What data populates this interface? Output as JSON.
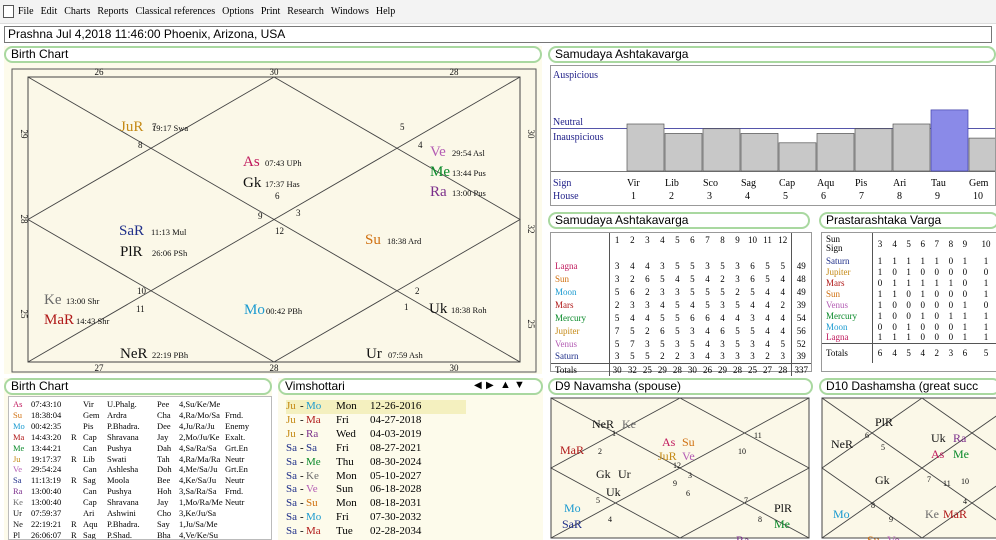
{
  "menu": [
    "File",
    "Edit",
    "Charts",
    "Reports",
    "Classical references",
    "Options",
    "Print",
    "Research",
    "Windows",
    "Help"
  ],
  "header": "Prashna   Jul 4,2018 11:46:00   Phoenix, Arizona, USA",
  "birth_chart": {
    "title": "Birth Chart",
    "outer_top": [
      "26",
      "30",
      "28"
    ],
    "outer_bottom": [
      "27",
      "28",
      "30"
    ],
    "outer_left": [
      "29",
      "28",
      "25"
    ],
    "outer_right": [
      "30",
      "32",
      "25"
    ],
    "house_numbers": [
      "7",
      "8",
      "6",
      "5",
      "4",
      "9",
      "3",
      "12",
      "10",
      "11",
      "1",
      "2"
    ],
    "planets": [
      {
        "abbr": "JuR",
        "info": "19:17 Swa",
        "color": "#c58a16"
      },
      {
        "abbr": "As",
        "info": "07:43 UPh",
        "color": "#c0185c"
      },
      {
        "abbr": "Gk",
        "info": "17:37 Has",
        "color": "#111111"
      },
      {
        "abbr": "Ve",
        "info": "29:54 Asl",
        "color": "#b35bb3"
      },
      {
        "abbr": "Me",
        "info": "13:44 Pus",
        "color": "#0a8a2a"
      },
      {
        "abbr": "Ra",
        "info": "13:00 Pus",
        "color": "#7a2d8a"
      },
      {
        "abbr": "SaR",
        "info": "11:13 Mul",
        "color": "#1f2f8a"
      },
      {
        "abbr": "PlR",
        "info": "26:06 PSh",
        "color": "#111111"
      },
      {
        "abbr": "Su",
        "info": "18:38 Ard",
        "color": "#d07010"
      },
      {
        "abbr": "Ke",
        "info": "13:00 Shr",
        "color": "#6a6a6a"
      },
      {
        "abbr": "MaR",
        "info": "14:43 Shr",
        "color": "#b01818"
      },
      {
        "abbr": "Mo",
        "info": "00:42 PBh",
        "color": "#1a9ad0"
      },
      {
        "abbr": "Uk",
        "info": "18:38 Roh",
        "color": "#111111"
      },
      {
        "abbr": "NeR",
        "info": "22:19 PBh",
        "color": "#111111"
      },
      {
        "abbr": "Ur",
        "info": "07:59 Ash",
        "color": "#111111"
      }
    ]
  },
  "samudaya_top": {
    "title": "Samudaya Ashtakavarga",
    "auspicious": "Auspicious",
    "neutral": "Neutral",
    "inauspicious": "Inauspicious",
    "sign_label": "Sign",
    "house_label": "House",
    "signs": [
      "Vir",
      "Lib",
      "Sco",
      "Sag",
      "Cap",
      "Aqu",
      "Pis",
      "Ari",
      "Tau",
      "Gem"
    ],
    "houses": [
      "1",
      "2",
      "3",
      "4",
      "5",
      "6",
      "7",
      "8",
      "9",
      "10"
    ],
    "bar_values": [
      30,
      28,
      29,
      28,
      26,
      28,
      29,
      30,
      33,
      27
    ],
    "highlight_index": 8
  },
  "samudaya_table": {
    "title": "Samudaya Ashtakavarga",
    "columns": [
      "1",
      "2",
      "3",
      "4",
      "5",
      "6",
      "7",
      "8",
      "9",
      "10",
      "11",
      "12"
    ],
    "rows": [
      {
        "name": "Lagna",
        "color": "#c0185c",
        "vals": [
          "3",
          "4",
          "4",
          "3",
          "5",
          "5",
          "3",
          "5",
          "3",
          "6",
          "5",
          "5"
        ],
        "total": "49"
      },
      {
        "name": "Sun",
        "color": "#d07010",
        "vals": [
          "3",
          "2",
          "6",
          "5",
          "4",
          "5",
          "4",
          "2",
          "3",
          "6",
          "5",
          "4"
        ],
        "total": "48"
      },
      {
        "name": "Moon",
        "color": "#1a9ad0",
        "vals": [
          "5",
          "6",
          "2",
          "3",
          "3",
          "5",
          "5",
          "5",
          "2",
          "5",
          "4",
          "4"
        ],
        "total": "49"
      },
      {
        "name": "Mars",
        "color": "#b01818",
        "vals": [
          "2",
          "3",
          "3",
          "4",
          "5",
          "4",
          "5",
          "3",
          "5",
          "4",
          "4",
          "2"
        ],
        "total": "39"
      },
      {
        "name": "Mercury",
        "color": "#0a8a2a",
        "vals": [
          "5",
          "4",
          "4",
          "5",
          "5",
          "6",
          "6",
          "4",
          "4",
          "3",
          "4",
          "4"
        ],
        "total": "54"
      },
      {
        "name": "Jupiter",
        "color": "#c58a16",
        "vals": [
          "7",
          "5",
          "2",
          "6",
          "5",
          "3",
          "4",
          "6",
          "5",
          "5",
          "4",
          "4"
        ],
        "total": "56"
      },
      {
        "name": "Venus",
        "color": "#b35bb3",
        "vals": [
          "5",
          "7",
          "3",
          "5",
          "3",
          "5",
          "4",
          "3",
          "5",
          "3",
          "4",
          "5"
        ],
        "total": "52"
      },
      {
        "name": "Saturn",
        "color": "#1f2f8a",
        "vals": [
          "3",
          "5",
          "5",
          "2",
          "2",
          "3",
          "4",
          "3",
          "3",
          "3",
          "2",
          "3"
        ],
        "total": "39"
      }
    ],
    "totals_label": "Totals",
    "totals": [
      "30",
      "32",
      "25",
      "29",
      "28",
      "30",
      "26",
      "29",
      "28",
      "25",
      "27",
      "28"
    ],
    "grand_total": "337"
  },
  "prastarashtaka": {
    "title": "Prastarashtaka Varga",
    "header_a": "Sun",
    "header_b": "Sign",
    "columns": [
      "3",
      "4",
      "5",
      "6",
      "7",
      "8",
      "9",
      "10"
    ],
    "rows": [
      {
        "name": "Saturn",
        "color": "#1f2f8a",
        "vals": [
          "1",
          "1",
          "1",
          "1",
          "1",
          "0",
          "1",
          "1"
        ]
      },
      {
        "name": "Jupiter",
        "color": "#c58a16",
        "vals": [
          "1",
          "0",
          "1",
          "0",
          "0",
          "0",
          "0",
          "0"
        ]
      },
      {
        "name": "Mars",
        "color": "#b01818",
        "vals": [
          "0",
          "1",
          "1",
          "1",
          "1",
          "1",
          "0",
          "1"
        ]
      },
      {
        "name": "Sun",
        "color": "#d07010",
        "vals": [
          "1",
          "1",
          "0",
          "1",
          "0",
          "0",
          "0",
          "1"
        ]
      },
      {
        "name": "Venus",
        "color": "#b35bb3",
        "vals": [
          "1",
          "0",
          "0",
          "0",
          "0",
          "0",
          "1",
          "0"
        ]
      },
      {
        "name": "Mercury",
        "color": "#0a8a2a",
        "vals": [
          "1",
          "0",
          "0",
          "1",
          "0",
          "1",
          "1",
          "1"
        ]
      },
      {
        "name": "Moon",
        "color": "#1a9ad0",
        "vals": [
          "0",
          "0",
          "1",
          "0",
          "0",
          "0",
          "1",
          "1"
        ]
      },
      {
        "name": "Lagna",
        "color": "#c0185c",
        "vals": [
          "1",
          "1",
          "1",
          "0",
          "0",
          "0",
          "1",
          "1"
        ]
      }
    ],
    "totals_label": "Totals",
    "totals": [
      "6",
      "4",
      "5",
      "4",
      "2",
      "3",
      "6",
      "5"
    ]
  },
  "birth_list": {
    "title": "Birth Chart",
    "rows": [
      {
        "p": "As",
        "c": "#c0185c",
        "deg": "07:43:10",
        "r": "",
        "sign": "Vir",
        "nak": "U.Phalg.",
        "pada": "Pee",
        "lord": "4,Su/Ke/Me",
        "st": ""
      },
      {
        "p": "Su",
        "c": "#d07010",
        "deg": "18:38:04",
        "r": "",
        "sign": "Gem",
        "nak": "Ardra",
        "pada": "Cha",
        "lord": "4,Ra/Mo/Sa",
        "st": "Frnd."
      },
      {
        "p": "Mo",
        "c": "#1a9ad0",
        "deg": "00:42:35",
        "r": "",
        "sign": "Pis",
        "nak": "P.Bhadra.",
        "pada": "Dee",
        "lord": "4,Ju/Ra/Ju",
        "st": "Enemy"
      },
      {
        "p": "Ma",
        "c": "#b01818",
        "deg": "14:43:20",
        "r": "R",
        "sign": "Cap",
        "nak": "Shravana",
        "pada": "Jay",
        "lord": "2,Mo/Ju/Ke",
        "st": "Exalt."
      },
      {
        "p": "Me",
        "c": "#0a8a2a",
        "deg": "13:44:21",
        "r": "",
        "sign": "Can",
        "nak": "Pushya",
        "pada": "Dah",
        "lord": "4,Sa/Ra/Sa",
        "st": "Grt.En"
      },
      {
        "p": "Ju",
        "c": "#c58a16",
        "deg": "19:17:37",
        "r": "R",
        "sign": "Lib",
        "nak": "Swati",
        "pada": "Tah",
        "lord": "4,Ra/Ma/Ra",
        "st": "Neutr"
      },
      {
        "p": "Ve",
        "c": "#b35bb3",
        "deg": "29:54:24",
        "r": "",
        "sign": "Can",
        "nak": "Ashlesha",
        "pada": "Doh",
        "lord": "4,Me/Sa/Ju",
        "st": "Grt.En"
      },
      {
        "p": "Sa",
        "c": "#1f2f8a",
        "deg": "11:13:19",
        "r": "R",
        "sign": "Sag",
        "nak": "Moola",
        "pada": "Bee",
        "lord": "4,Ke/Sa/Ju",
        "st": "Neutr"
      },
      {
        "p": "Ra",
        "c": "#7a2d8a",
        "deg": "13:00:40",
        "r": "",
        "sign": "Can",
        "nak": "Pushya",
        "pada": "Hoh",
        "lord": "3,Sa/Ra/Sa",
        "st": "Frnd."
      },
      {
        "p": "Ke",
        "c": "#6a6a6a",
        "deg": "13:00:40",
        "r": "",
        "sign": "Cap",
        "nak": "Shravana",
        "pada": "Jay",
        "lord": "1,Mo/Ra/Me",
        "st": "Neutr"
      },
      {
        "p": "Ur",
        "c": "#111111",
        "deg": "07:59:37",
        "r": "",
        "sign": "Ari",
        "nak": "Ashwini",
        "pada": "Cho",
        "lord": "3,Ke/Ju/Sa",
        "st": ""
      },
      {
        "p": "Ne",
        "c": "#111111",
        "deg": "22:19:21",
        "r": "R",
        "sign": "Aqu",
        "nak": "P.Bhadra.",
        "pada": "Say",
        "lord": "1,Ju/Sa/Me",
        "st": ""
      },
      {
        "p": "Pl",
        "c": "#111111",
        "deg": "26:06:07",
        "r": "R",
        "sign": "Sag",
        "nak": "P.Shad.",
        "pada": "Bha",
        "lord": "4,Ve/Ke/Su",
        "st": ""
      }
    ]
  },
  "vimshottari": {
    "title": "Vimshottari",
    "rows": [
      {
        "a": "Ju",
        "ac": "#c58a16",
        "b": "Mo",
        "bc": "#1a9ad0",
        "day": "Mon",
        "date": "12-26-2016",
        "hl": true
      },
      {
        "a": "Ju",
        "ac": "#c58a16",
        "b": "Ma",
        "bc": "#b01818",
        "day": "Fri",
        "date": "04-27-2018",
        "hl": false
      },
      {
        "a": "Ju",
        "ac": "#c58a16",
        "b": "Ra",
        "bc": "#7a2d8a",
        "day": "Wed",
        "date": "04-03-2019",
        "hl": false
      },
      {
        "a": "Sa",
        "ac": "#1f2f8a",
        "b": "Sa",
        "bc": "#1f2f8a",
        "day": "Fri",
        "date": "08-27-2021",
        "hl": false
      },
      {
        "a": "Sa",
        "ac": "#1f2f8a",
        "b": "Me",
        "bc": "#0a8a2a",
        "day": "Thu",
        "date": "08-30-2024",
        "hl": false
      },
      {
        "a": "Sa",
        "ac": "#1f2f8a",
        "b": "Ke",
        "bc": "#6a6a6a",
        "day": "Mon",
        "date": "05-10-2027",
        "hl": false
      },
      {
        "a": "Sa",
        "ac": "#1f2f8a",
        "b": "Ve",
        "bc": "#b35bb3",
        "day": "Sun",
        "date": "06-18-2028",
        "hl": false
      },
      {
        "a": "Sa",
        "ac": "#1f2f8a",
        "b": "Su",
        "bc": "#d07010",
        "day": "Mon",
        "date": "08-18-2031",
        "hl": false
      },
      {
        "a": "Sa",
        "ac": "#1f2f8a",
        "b": "Mo",
        "bc": "#1a9ad0",
        "day": "Fri",
        "date": "07-30-2032",
        "hl": false
      },
      {
        "a": "Sa",
        "ac": "#1f2f8a",
        "b": "Ma",
        "bc": "#b01818",
        "day": "Tue",
        "date": "02-28-2034",
        "hl": false
      }
    ]
  },
  "d9": {
    "title": "D9 Navamsha  (spouse)",
    "labels": [
      {
        "t": "NeR",
        "c": "#111111"
      },
      {
        "t": "Ke",
        "c": "#6a6a6a"
      },
      {
        "t": "MaR",
        "c": "#b01818"
      },
      {
        "t": "As",
        "c": "#c0185c"
      },
      {
        "t": "Su",
        "c": "#d07010"
      },
      {
        "t": "JuR",
        "c": "#c58a16"
      },
      {
        "t": "Ve",
        "c": "#b35bb3"
      },
      {
        "t": "Gk",
        "c": "#111111"
      },
      {
        "t": "Ur",
        "c": "#111111"
      },
      {
        "t": "Uk",
        "c": "#111111"
      },
      {
        "t": "Mo",
        "c": "#1a9ad0"
      },
      {
        "t": "SaR",
        "c": "#1f2f8a"
      },
      {
        "t": "PlR",
        "c": "#111111"
      },
      {
        "t": "Me",
        "c": "#0a8a2a"
      },
      {
        "t": "Ra",
        "c": "#7a2d8a"
      }
    ],
    "nums": [
      "1",
      "2",
      "11",
      "10",
      "12",
      "9",
      "3",
      "6",
      "5",
      "4",
      "7",
      "8"
    ]
  },
  "d10": {
    "title": "D10 Dashamsha  (great succ",
    "labels": [
      {
        "t": "PlR",
        "c": "#111111"
      },
      {
        "t": "NeR",
        "c": "#111111"
      },
      {
        "t": "Uk",
        "c": "#111111"
      },
      {
        "t": "Ra",
        "c": "#7a2d8a"
      },
      {
        "t": "As",
        "c": "#c0185c"
      },
      {
        "t": "Me",
        "c": "#0a8a2a"
      },
      {
        "t": "Gk",
        "c": "#111111"
      },
      {
        "t": "Mo",
        "c": "#1a9ad0"
      },
      {
        "t": "Ke",
        "c": "#6a6a6a"
      },
      {
        "t": "MaR",
        "c": "#b01818"
      },
      {
        "t": "Su",
        "c": "#d07010"
      },
      {
        "t": "Ve",
        "c": "#b35bb3"
      }
    ],
    "nums": [
      "6",
      "5",
      "7",
      "10",
      "11",
      "8",
      "9",
      "4"
    ]
  }
}
